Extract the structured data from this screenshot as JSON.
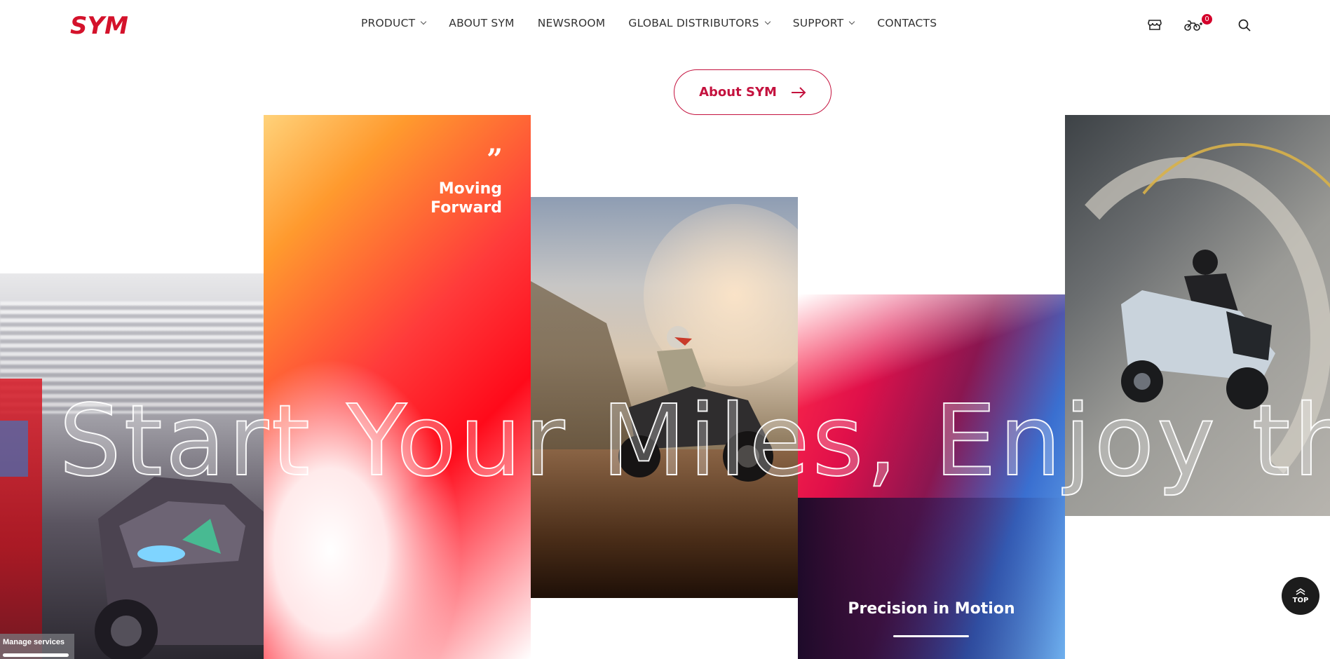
{
  "header": {
    "logo_text": "SYM",
    "nav": [
      {
        "label": "PRODUCT",
        "has_dropdown": true
      },
      {
        "label": "ABOUT SYM",
        "has_dropdown": false
      },
      {
        "label": "NEWSROOM",
        "has_dropdown": false
      },
      {
        "label": "GLOBAL DISTRIBUTORS",
        "has_dropdown": true
      },
      {
        "label": "SUPPORT",
        "has_dropdown": true
      },
      {
        "label": "CONTACTS",
        "has_dropdown": false
      }
    ],
    "icons": [
      "store-icon",
      "motorcycle-compare-icon",
      "search-icon"
    ],
    "compare_count": "0"
  },
  "about_button": {
    "label": "About SYM"
  },
  "panels": {
    "quote_mark": "”",
    "quote_line1": "Moving",
    "quote_line2": "Forward",
    "precision_title": "Precision in Motion"
  },
  "slogan": "Start Your Miles, Enjoy the",
  "top_button": {
    "label": "TOP"
  },
  "manage_services": {
    "label": "Manage services"
  },
  "colors": {
    "brand_red": "#c4123e",
    "badge_red": "#d4002a",
    "dark": "#1c1c1c"
  }
}
